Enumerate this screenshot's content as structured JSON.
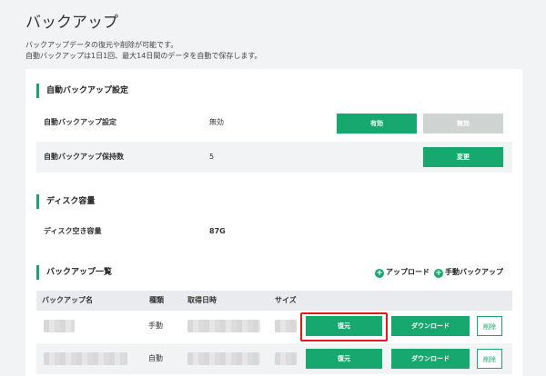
{
  "page": {
    "title": "バックアップ",
    "desc1": "バックアップデータの復元や削除が可能です。",
    "desc2": "自動バックアップは1日1回、最大14日間のデータを自動で保存します。"
  },
  "auto_backup": {
    "section_title": "自動バックアップ設定",
    "setting_label": "自動バックアップ設定",
    "setting_value": "無効",
    "enable_button": "有効",
    "disable_button": "無効",
    "retention_label": "自動バックアップ保持数",
    "retention_value": "5",
    "change_button": "変更"
  },
  "disk": {
    "section_title": "ディスク容量",
    "free_label": "ディスク空き容量",
    "free_value": "87G"
  },
  "backup_list": {
    "section_title": "バックアップ一覧",
    "upload_button": "アップロード",
    "manual_button": "手動バックアップ",
    "columns": [
      "バックアップ名",
      "種類",
      "取得日時",
      "サイズ"
    ],
    "rows": [
      {
        "type": "手動",
        "restore": "復元",
        "download": "ダウンロード",
        "delete": "削除"
      },
      {
        "type": "自動",
        "restore": "復元",
        "download": "ダウンロード",
        "delete": "削除"
      }
    ]
  },
  "colors": {
    "accent": "#16a86e",
    "highlight": "#e31b1b",
    "disabled": "#cfd3d2"
  },
  "icons": {
    "plus": "plus-circle-icon"
  }
}
